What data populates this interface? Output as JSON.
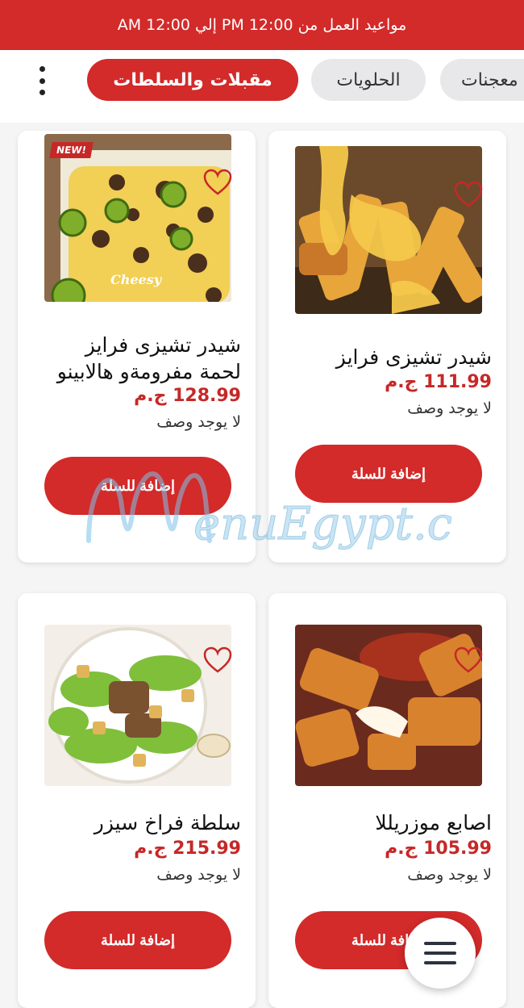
{
  "header": {
    "hours_text": "مواعيد العمل من 12:00 PM إلي 12:00 AM"
  },
  "tabs": [
    {
      "label": "معجنات",
      "active": false
    },
    {
      "label": "الحلويات",
      "active": false
    },
    {
      "label": "مقبلات والسلطات",
      "active": true
    }
  ],
  "products": [
    {
      "title": "شيدر تشيزى فرايز",
      "price": "111.99 ج.م",
      "description": "لا يوجد وصف",
      "button": "إضافة للسلة",
      "image": "cheese-fries-photo"
    },
    {
      "title": "شيدر تشيزى فرايز لحمة مفرومةو هالابينو",
      "price": "128.99 ج.م",
      "description": "لا يوجد وصف",
      "button": "إضافة للسلة",
      "image": "beef-jalapeno-fries-photo",
      "badge": "NEW!",
      "caption": "Cheesy"
    },
    {
      "title": "اصابع موزريللا",
      "price": "105.99 ج.م",
      "description": "لا يوجد وصف",
      "button": "إضافة للسلة",
      "image": "mozzarella-sticks-photo"
    },
    {
      "title": "سلطة فراخ سيزر",
      "price": "215.99 ج.م",
      "description": "لا يوجد وصف",
      "button": "إضافة للسلة",
      "image": "caesar-salad-photo"
    }
  ],
  "watermark": "MenuEgypt.com",
  "colors": {
    "brand_red": "#d32a2a",
    "price_red": "#c62828"
  },
  "icons": {
    "more": "kebab-menu-icon",
    "favorite": "heart-outline-icon",
    "menu": "hamburger-icon"
  }
}
